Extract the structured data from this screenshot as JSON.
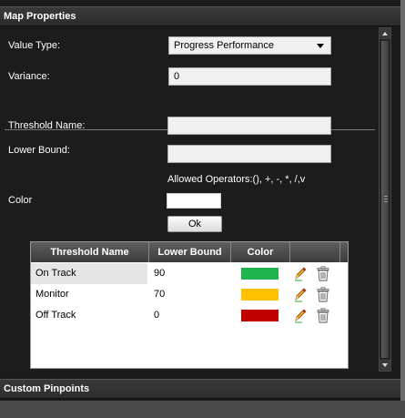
{
  "panels": {
    "map_properties": "Map Properties",
    "custom_pinpoints": "Custom Pinpoints"
  },
  "form": {
    "value_type_label": "Value Type:",
    "value_type_value": "Progress Performance",
    "variance_label": "Variance:",
    "variance_value": "0",
    "threshold_name_label": "Threshold Name:",
    "threshold_name_value": "",
    "lower_bound_label": "Lower Bound:",
    "lower_bound_value": "",
    "allowed_operators": "Allowed Operators:(), +, -, *, /,v",
    "color_label": "Color",
    "color_value": "#ffffff",
    "ok_label": "Ok"
  },
  "grid": {
    "headers": [
      "Threshold Name",
      "Lower Bound",
      "Color",
      "",
      ""
    ],
    "rows": [
      {
        "name": "On Track",
        "lower_bound": "90",
        "color": "#1fb44e"
      },
      {
        "name": "Monitor",
        "lower_bound": "70",
        "color": "#ffc000"
      },
      {
        "name": "Off Track",
        "lower_bound": "0",
        "color": "#c00000"
      }
    ],
    "row_icons": [
      "pencil-edit-icon",
      "trash-delete-icon"
    ]
  }
}
